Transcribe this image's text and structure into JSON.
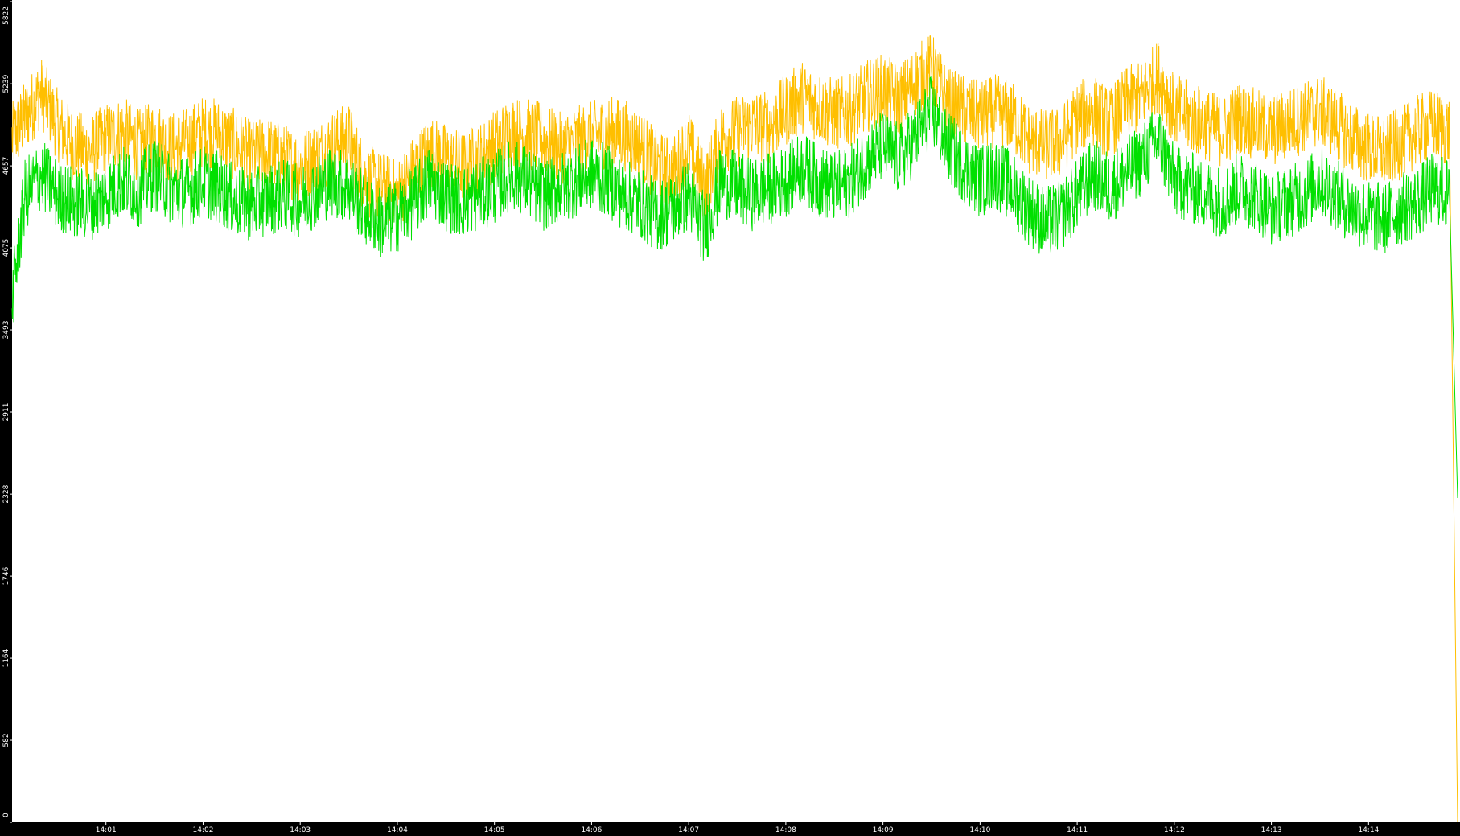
{
  "chart_data": {
    "type": "line",
    "title": "",
    "xlabel": "",
    "ylabel": "",
    "ylim": [
      0,
      5822
    ],
    "xlim": [
      "14:00:02",
      "14:14:55"
    ],
    "y_tick_labels": [
      "0",
      "582",
      "1164",
      "1746",
      "2328",
      "2911",
      "3493",
      "4075",
      "4657",
      "5239",
      "5822"
    ],
    "x_tick_labels": [
      "14:01",
      "14:02",
      "14:03",
      "14:04",
      "14:05",
      "14:06",
      "14:07",
      "14:08",
      "14:09",
      "14:10",
      "14:11",
      "14:12",
      "14:13",
      "14:14"
    ],
    "grid": false,
    "legend": "none",
    "axis_background": "#000000",
    "series": [
      {
        "color": "#ffbf00",
        "points": [
          [
            "14:00:02",
            4850
          ],
          [
            "14:00:10",
            5000
          ],
          [
            "14:00:20",
            5180
          ],
          [
            "14:00:30",
            4950
          ],
          [
            "14:00:40",
            4800
          ],
          [
            "14:00:50",
            4760
          ],
          [
            "14:01:00",
            4850
          ],
          [
            "14:01:10",
            4900
          ],
          [
            "14:01:20",
            4800
          ],
          [
            "14:01:30",
            4870
          ],
          [
            "14:01:40",
            4780
          ],
          [
            "14:01:50",
            4820
          ],
          [
            "14:02:00",
            4900
          ],
          [
            "14:02:10",
            4880
          ],
          [
            "14:02:20",
            4800
          ],
          [
            "14:02:30",
            4720
          ],
          [
            "14:02:40",
            4750
          ],
          [
            "14:02:50",
            4700
          ],
          [
            "14:03:00",
            4650
          ],
          [
            "14:03:10",
            4720
          ],
          [
            "14:03:20",
            4800
          ],
          [
            "14:03:30",
            4850
          ],
          [
            "14:03:40",
            4560
          ],
          [
            "14:03:50",
            4500
          ],
          [
            "14:04:00",
            4450
          ],
          [
            "14:04:10",
            4620
          ],
          [
            "14:04:20",
            4760
          ],
          [
            "14:04:30",
            4700
          ],
          [
            "14:04:40",
            4650
          ],
          [
            "14:04:50",
            4700
          ],
          [
            "14:05:00",
            4800
          ],
          [
            "14:05:10",
            4900
          ],
          [
            "14:05:20",
            4880
          ],
          [
            "14:05:30",
            4850
          ],
          [
            "14:05:40",
            4780
          ],
          [
            "14:05:50",
            4820
          ],
          [
            "14:06:00",
            4860
          ],
          [
            "14:06:10",
            4900
          ],
          [
            "14:06:20",
            4880
          ],
          [
            "14:06:30",
            4800
          ],
          [
            "14:06:40",
            4650
          ],
          [
            "14:06:50",
            4600
          ],
          [
            "14:07:00",
            4800
          ],
          [
            "14:07:10",
            4500
          ],
          [
            "14:07:20",
            4850
          ],
          [
            "14:07:30",
            4900
          ],
          [
            "14:07:40",
            4950
          ],
          [
            "14:07:50",
            4930
          ],
          [
            "14:08:00",
            5050
          ],
          [
            "14:08:10",
            5150
          ],
          [
            "14:08:20",
            5080
          ],
          [
            "14:08:30",
            5020
          ],
          [
            "14:08:40",
            5050
          ],
          [
            "14:08:50",
            5150
          ],
          [
            "14:09:00",
            5200
          ],
          [
            "14:09:10",
            5120
          ],
          [
            "14:09:20",
            5250
          ],
          [
            "14:09:30",
            5350
          ],
          [
            "14:09:40",
            5100
          ],
          [
            "14:09:50",
            5050
          ],
          [
            "14:10:00",
            5000
          ],
          [
            "14:10:10",
            5050
          ],
          [
            "14:10:20",
            5000
          ],
          [
            "14:10:30",
            4850
          ],
          [
            "14:10:40",
            4800
          ],
          [
            "14:10:50",
            4820
          ],
          [
            "14:11:00",
            5000
          ],
          [
            "14:11:10",
            5050
          ],
          [
            "14:11:20",
            4950
          ],
          [
            "14:11:30",
            5100
          ],
          [
            "14:11:40",
            5150
          ],
          [
            "14:11:50",
            5300
          ],
          [
            "14:12:00",
            5050
          ],
          [
            "14:12:10",
            5000
          ],
          [
            "14:12:20",
            4950
          ],
          [
            "14:12:30",
            4900
          ],
          [
            "14:12:40",
            5000
          ],
          [
            "14:12:50",
            4950
          ],
          [
            "14:13:00",
            4900
          ],
          [
            "14:13:10",
            4950
          ],
          [
            "14:13:20",
            5000
          ],
          [
            "14:13:30",
            5050
          ],
          [
            "14:13:40",
            4950
          ],
          [
            "14:13:50",
            4850
          ],
          [
            "14:14:00",
            4780
          ],
          [
            "14:14:10",
            4750
          ],
          [
            "14:14:20",
            4820
          ],
          [
            "14:14:30",
            4900
          ],
          [
            "14:14:40",
            4950
          ],
          [
            "14:14:50",
            4900
          ],
          [
            "14:14:55",
            0
          ]
        ]
      },
      {
        "color": "#00e000",
        "points": [
          [
            "14:00:02",
            3700
          ],
          [
            "14:00:10",
            4450
          ],
          [
            "14:00:20",
            4600
          ],
          [
            "14:00:30",
            4450
          ],
          [
            "14:00:40",
            4400
          ],
          [
            "14:00:50",
            4380
          ],
          [
            "14:01:00",
            4450
          ],
          [
            "14:01:10",
            4550
          ],
          [
            "14:01:20",
            4480
          ],
          [
            "14:01:30",
            4600
          ],
          [
            "14:01:40",
            4500
          ],
          [
            "14:01:50",
            4470
          ],
          [
            "14:02:00",
            4550
          ],
          [
            "14:02:10",
            4500
          ],
          [
            "14:02:20",
            4400
          ],
          [
            "14:02:30",
            4380
          ],
          [
            "14:02:40",
            4420
          ],
          [
            "14:02:50",
            4450
          ],
          [
            "14:03:00",
            4400
          ],
          [
            "14:03:10",
            4480
          ],
          [
            "14:03:20",
            4550
          ],
          [
            "14:03:30",
            4500
          ],
          [
            "14:03:40",
            4350
          ],
          [
            "14:03:50",
            4250
          ],
          [
            "14:04:00",
            4300
          ],
          [
            "14:04:10",
            4400
          ],
          [
            "14:04:20",
            4550
          ],
          [
            "14:04:30",
            4450
          ],
          [
            "14:04:40",
            4400
          ],
          [
            "14:04:50",
            4450
          ],
          [
            "14:05:00",
            4500
          ],
          [
            "14:05:10",
            4600
          ],
          [
            "14:05:20",
            4550
          ],
          [
            "14:05:30",
            4450
          ],
          [
            "14:05:40",
            4500
          ],
          [
            "14:05:50",
            4550
          ],
          [
            "14:06:00",
            4600
          ],
          [
            "14:06:10",
            4550
          ],
          [
            "14:06:20",
            4450
          ],
          [
            "14:06:30",
            4400
          ],
          [
            "14:06:40",
            4300
          ],
          [
            "14:06:50",
            4350
          ],
          [
            "14:07:00",
            4450
          ],
          [
            "14:07:10",
            4200
          ],
          [
            "14:07:20",
            4550
          ],
          [
            "14:07:30",
            4500
          ],
          [
            "14:07:40",
            4450
          ],
          [
            "14:07:50",
            4500
          ],
          [
            "14:08:00",
            4550
          ],
          [
            "14:08:10",
            4650
          ],
          [
            "14:08:20",
            4550
          ],
          [
            "14:08:30",
            4500
          ],
          [
            "14:08:40",
            4550
          ],
          [
            "14:08:50",
            4700
          ],
          [
            "14:09:00",
            4800
          ],
          [
            "14:09:10",
            4700
          ],
          [
            "14:09:20",
            4850
          ],
          [
            "14:09:30",
            5050
          ],
          [
            "14:09:40",
            4800
          ],
          [
            "14:09:50",
            4650
          ],
          [
            "14:10:00",
            4550
          ],
          [
            "14:10:10",
            4600
          ],
          [
            "14:10:20",
            4500
          ],
          [
            "14:10:30",
            4350
          ],
          [
            "14:10:40",
            4250
          ],
          [
            "14:10:50",
            4300
          ],
          [
            "14:11:00",
            4450
          ],
          [
            "14:11:10",
            4600
          ],
          [
            "14:11:20",
            4500
          ],
          [
            "14:11:30",
            4600
          ],
          [
            "14:11:40",
            4700
          ],
          [
            "14:11:50",
            4850
          ],
          [
            "14:12:00",
            4550
          ],
          [
            "14:12:10",
            4500
          ],
          [
            "14:12:20",
            4450
          ],
          [
            "14:12:30",
            4400
          ],
          [
            "14:12:40",
            4500
          ],
          [
            "14:12:50",
            4450
          ],
          [
            "14:13:00",
            4350
          ],
          [
            "14:13:10",
            4400
          ],
          [
            "14:13:20",
            4450
          ],
          [
            "14:13:30",
            4550
          ],
          [
            "14:13:40",
            4450
          ],
          [
            "14:13:50",
            4350
          ],
          [
            "14:14:00",
            4300
          ],
          [
            "14:14:10",
            4280
          ],
          [
            "14:14:20",
            4350
          ],
          [
            "14:14:30",
            4400
          ],
          [
            "14:14:40",
            4500
          ],
          [
            "14:14:50",
            4450
          ],
          [
            "14:14:55",
            2300
          ]
        ]
      }
    ]
  }
}
